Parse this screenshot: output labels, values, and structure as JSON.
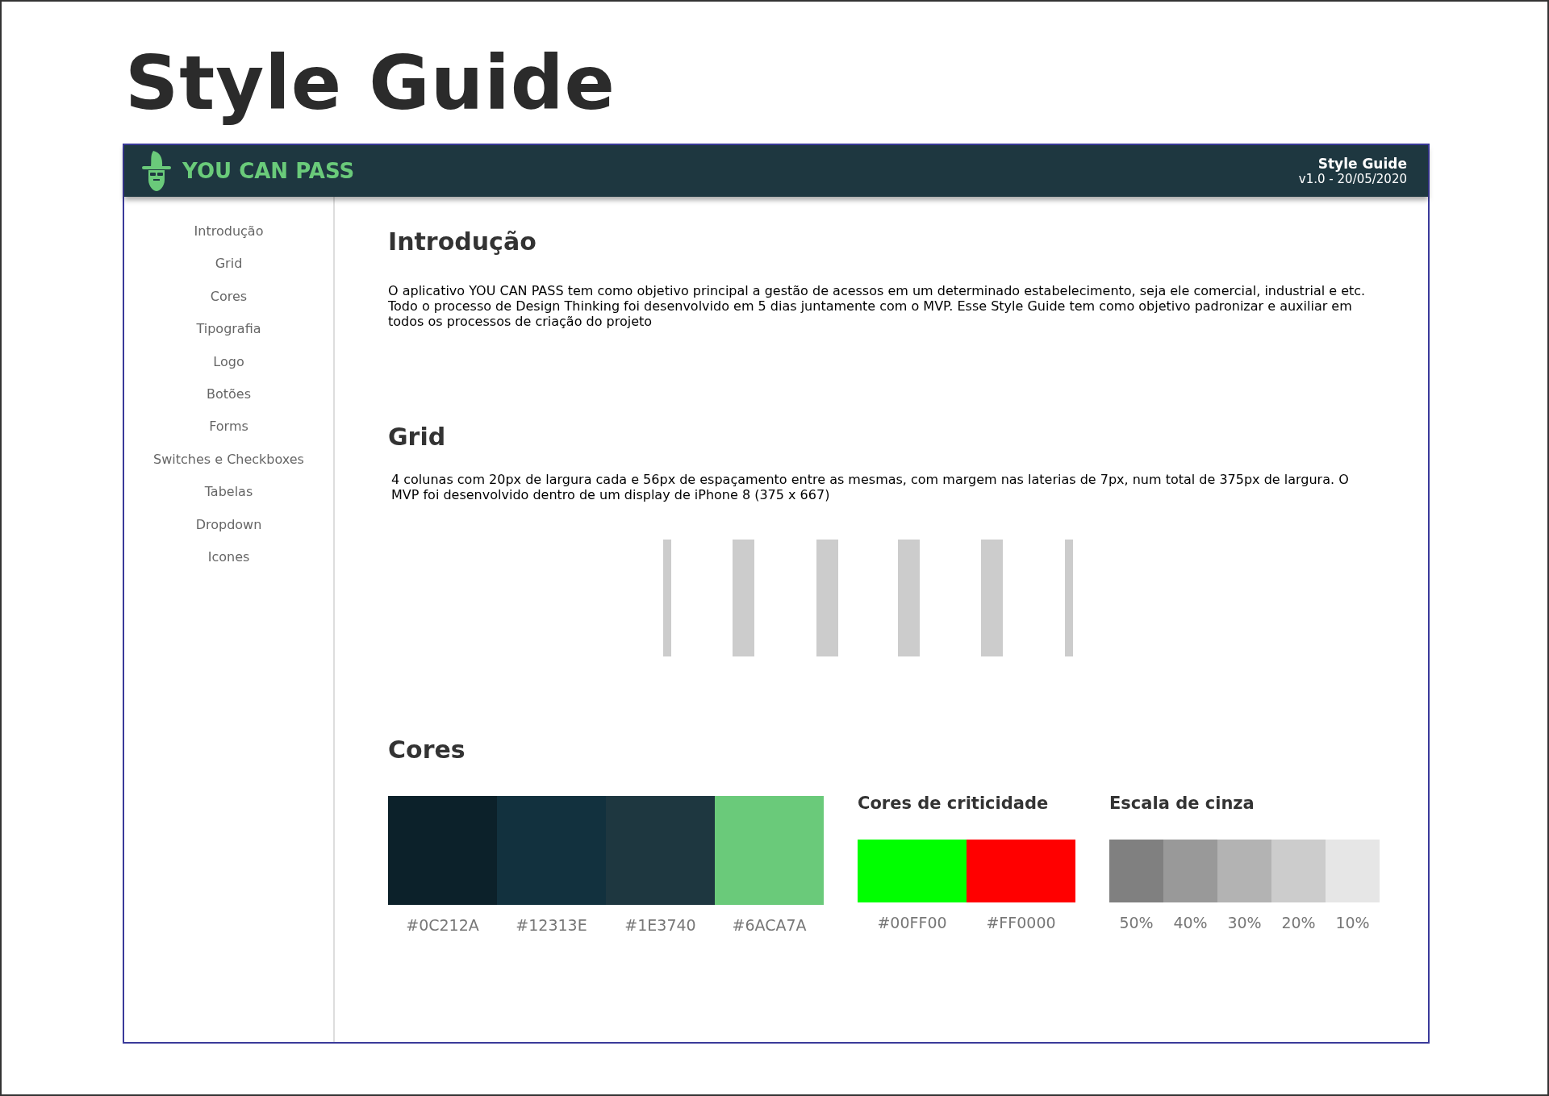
{
  "page_title": "Style Guide",
  "header": {
    "brand": "YOU CAN PASS",
    "doc_title": "Style Guide",
    "version": "v1.0 - 20/05/2020"
  },
  "sidebar": {
    "items": [
      "Introdução",
      "Grid",
      "Cores",
      "Tipografia",
      "Logo",
      "Botões",
      "Forms",
      "Switches e Checkboxes",
      "Tabelas",
      "Dropdown",
      "Icones"
    ]
  },
  "intro": {
    "heading": "Introdução",
    "text": "O aplicativo YOU CAN PASS tem como objetivo principal a gestão de acessos em um determinado estabelecimento, seja ele comercial, industrial e etc. Todo o processo de Design Thinking foi desenvolvido em 5 dias juntamente com o MVP. Esse Style Guide tem como objetivo padronizar e auxiliar em todos os processos de criação do projeto"
  },
  "grid": {
    "heading": "Grid",
    "text": "4 colunas com 20px de largura cada e 56px de espaçamento entre as mesmas, com margem nas laterias de 7px, num total de 375px de largura. O MVP foi desenvolvido dentro de um display de iPhone 8 (375 x 667)"
  },
  "colors": {
    "heading": "Cores",
    "groups": [
      {
        "kind": "main",
        "swatches": [
          {
            "label": "#0C212A",
            "color": "#0c212a"
          },
          {
            "label": "#12313E",
            "color": "#12313e"
          },
          {
            "label": "#1E3740",
            "color": "#1e3740"
          },
          {
            "label": "#6ACA7A",
            "color": "#6aca7a"
          }
        ]
      },
      {
        "kind": "criticality",
        "title": "Cores de criticidade",
        "swatches": [
          {
            "label": "#00FF00",
            "color": "#00ff00"
          },
          {
            "label": "#FF0000",
            "color": "#ff0000"
          }
        ]
      },
      {
        "kind": "grayscale",
        "title": "Escala de cinza",
        "swatches": [
          {
            "label": "50%",
            "color": "#808080"
          },
          {
            "label": "40%",
            "color": "#999999"
          },
          {
            "label": "30%",
            "color": "#b3b3b3"
          },
          {
            "label": "20%",
            "color": "#cccccc"
          },
          {
            "label": "10%",
            "color": "#e6e6e6"
          }
        ]
      }
    ]
  }
}
